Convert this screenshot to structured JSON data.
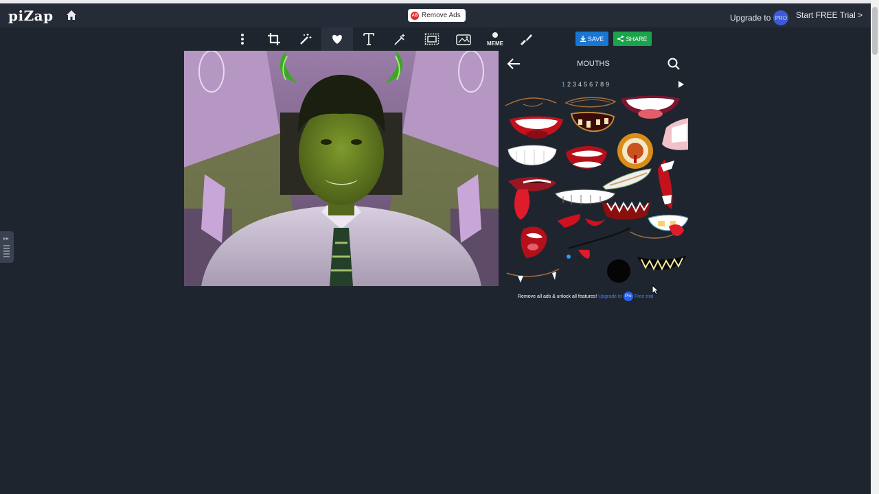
{
  "header": {
    "logo": "piZap",
    "remove_ads": "Remove Ads",
    "adblock_icon_text": "AB",
    "upgrade_to": "Upgrade to",
    "pro_badge": "PRO",
    "start_trial": "Start FREE Trial >"
  },
  "toolbar": {
    "icons": [
      "more-vertical-icon",
      "crop-icon",
      "magic-wand-icon",
      "heart-sticker-icon",
      "text-icon",
      "effects-icon",
      "border-icon",
      "collage-icon",
      "meme-icon",
      "paint-brush-icon"
    ],
    "meme_label": "MEME",
    "save_label": "SAVE",
    "share_label": "SHARE"
  },
  "panel": {
    "title": "MOUTHS",
    "pages": [
      "1",
      "2",
      "3",
      "4",
      "5",
      "6",
      "7",
      "8",
      "9"
    ],
    "active_page": "1",
    "promo_text": "Remove all ads & unlock all features!",
    "promo_link": "Upgrade to",
    "promo_badge": "Pro",
    "promo_trial": "Free trial"
  },
  "colors": {
    "background": "#1f252e",
    "topbar": "#262c37",
    "save": "#1976d2",
    "share": "#1aa34a",
    "accent_link": "#3b82f6"
  }
}
